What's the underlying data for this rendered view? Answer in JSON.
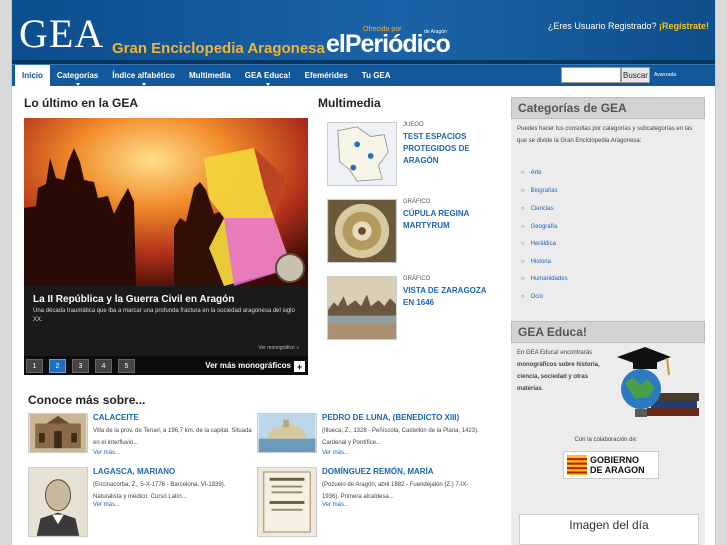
{
  "header": {
    "logo": "GEA",
    "subtitle": "Gran Enciclopedia Aragonesa",
    "offered_by": "Ofrecido por",
    "partner": "elPeriódico",
    "partner_small": "de Aragón",
    "user_question": "¿Eres Usuario Registrado?",
    "register_link": "¡Regístrate!"
  },
  "nav": {
    "items": [
      {
        "label": "Inicio",
        "active": true,
        "dropdown": false
      },
      {
        "label": "Categorías",
        "active": false,
        "dropdown": true
      },
      {
        "label": "Índice alfabético",
        "active": false,
        "dropdown": true
      },
      {
        "label": "Multimedia",
        "active": false,
        "dropdown": false
      },
      {
        "label": "GEA Educa!",
        "active": false,
        "dropdown": true
      },
      {
        "label": "Efemérides",
        "active": false,
        "dropdown": false
      },
      {
        "label": "Tu GEA",
        "active": false,
        "dropdown": false
      }
    ],
    "search_button": "Buscar",
    "advanced": "Avanzada"
  },
  "latest": {
    "title": "Lo último en la GEA",
    "feature_title": "La II República y la Guerra Civil en Aragón",
    "feature_desc": "Una década traumática que iba a marcar una profunda fractura en la sociedad aragonesa del siglo XX.",
    "feature_more": "Ver monográfico »",
    "pages": [
      "1",
      "2",
      "3",
      "4",
      "5"
    ],
    "active_page": 1,
    "more_monographs": "Ver más monográficos"
  },
  "multimedia": {
    "title": "Multimedia",
    "items": [
      {
        "type": "JUEGO",
        "title": "TEST ESPACIOS PROTEGIDOS DE ARAGÓN"
      },
      {
        "type": "GRÁFICO",
        "title": "CÚPULA REGINA MARTYRUM"
      },
      {
        "type": "GRÁFICO",
        "title": "VISTA DE ZARAGOZA EN 1646"
      }
    ]
  },
  "conoce": {
    "title": "Conoce más sobre...",
    "more_label": "Ver más...",
    "items": [
      {
        "title": "CALACEITE",
        "desc": "Villa de la prov. de Teruel, a 196,7 km. de la capital. Situada en el interfluvio..."
      },
      {
        "title": "PEDRO DE LUNA, (BENEDICTO XIII)",
        "desc": "(Illueca, Z., 1328 - Peñíscola, Castellón de la Plana, 1423). Cardenal y Pontífice..."
      },
      {
        "title": "LAGASCA, MARIANO",
        "desc": "(Encinacorba, Z., 5-X-1776 - Barcelona, VI-1839). Naturalista y médico. Cursó Latín..."
      },
      {
        "title": "DOMÍNGUEZ REMÓN, MARÍA",
        "desc": "(Pozuelo de Aragón, abril 1882 - Fuendejalón (Z.) 7-IX-1936). Primera alcaldesa..."
      }
    ]
  },
  "sidebar": {
    "categories_title": "Categorías de GEA",
    "categories_text": "Puedes hacer tus consultas por categorías y subcategorías en las que se divide la Gran Enciclopedia Aragonesa:",
    "categories": [
      "Arte",
      "Biografías",
      "Ciencias",
      "Geografía",
      "Heráldica",
      "Historia",
      "Humanidades",
      "Ocio"
    ],
    "educa_title": "GEA Educa!",
    "educa_text_1": "En GEA Educa! encontrarás",
    "educa_text_bold": "monográficos sobre historia, ciencia, sociedad y otras materias",
    "educa_text_end": ".",
    "collab": "Con la colaboración de:",
    "gov_line1": "GOBIERNO",
    "gov_line2": "DE ARAGON",
    "image_day": "Imagen del día"
  },
  "colors": {
    "header_blue": "#14589c",
    "link_blue": "#1a66b5",
    "accent_orange": "#f5b335"
  }
}
